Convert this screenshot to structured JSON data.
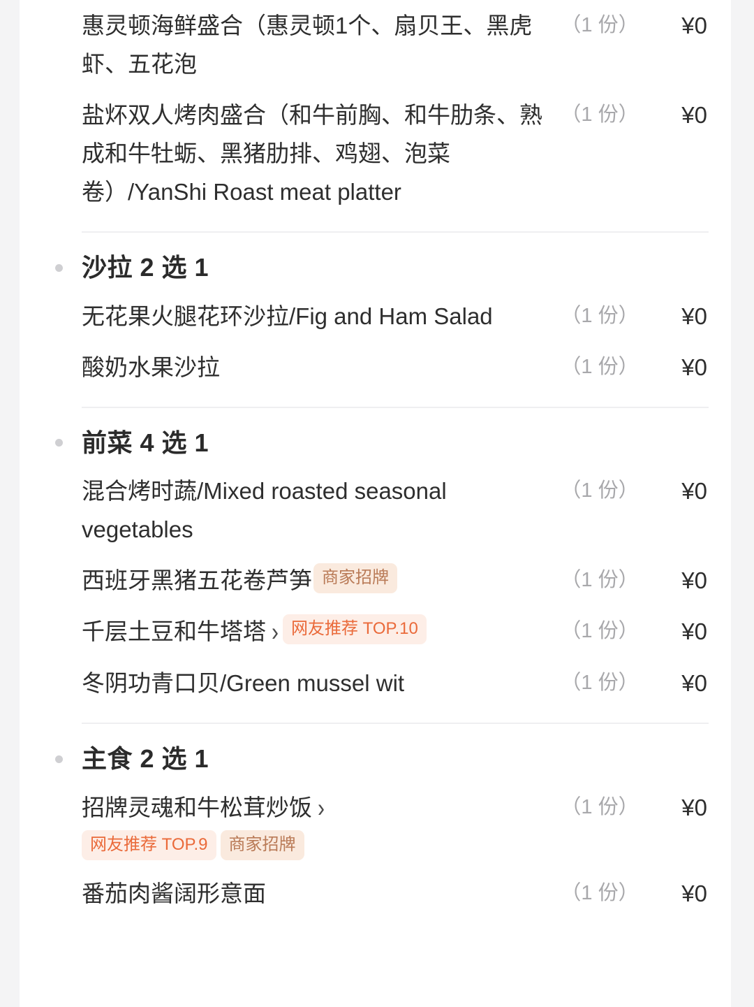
{
  "colors": {
    "page_background": "#f4f4f5",
    "card_background": "#ffffff",
    "primary_text": "#2e2e2e",
    "muted_text": "#a8a8ab",
    "divider": "#efeff1",
    "badge_top_bg": "#fdeee7",
    "badge_top_text": "#ea6a3a",
    "badge_merchant_bg": "#faeade",
    "badge_merchant_text": "#b97a56",
    "bullet": "#cfcfd2"
  },
  "labels": {
    "qty_one_portion": "（1 份）",
    "price_zero": "¥0",
    "chevron": "›"
  },
  "groups": [
    {
      "title": "",
      "has_header": false,
      "dishes": [
        {
          "name": "惠灵顿海鲜盛合（惠灵顿1个、扇贝王、黑虎虾、五花泡",
          "has_chevron": false,
          "badges": [],
          "badges_below": [],
          "qty": "（1 份）",
          "price": "¥0"
        },
        {
          "name": "盐炋双人烤肉盛合（和牛前胸、和牛肋条、熟成和牛牡蛎、黑猪肋排、鸡翅、泡菜卷）/YanShi Roast meat platter",
          "has_chevron": false,
          "badges": [],
          "badges_below": [],
          "qty": "（1 份）",
          "price": "¥0"
        }
      ]
    },
    {
      "title": "沙拉 2 选 1",
      "has_header": true,
      "dishes": [
        {
          "name": "无花果火腿花环沙拉/Fig and Ham Salad",
          "has_chevron": false,
          "badges": [],
          "badges_below": [],
          "qty": "（1 份）",
          "price": "¥0"
        },
        {
          "name": "酸奶水果沙拉",
          "has_chevron": false,
          "badges": [],
          "badges_below": [],
          "qty": "（1 份）",
          "price": "¥0"
        }
      ]
    },
    {
      "title": "前菜 4 选 1",
      "has_header": true,
      "dishes": [
        {
          "name": "混合烤时蔬/Mixed roasted seasonal vegetables",
          "has_chevron": false,
          "badges": [],
          "badges_below": [],
          "qty": "（1 份）",
          "price": "¥0"
        },
        {
          "name": "西班牙黑猪五花卷芦笋",
          "has_chevron": false,
          "badges": [
            {
              "text": "商家招牌",
              "kind": "merchant"
            }
          ],
          "badges_below": [],
          "qty": "（1 份）",
          "price": "¥0"
        },
        {
          "name": "千层土豆和牛塔塔",
          "has_chevron": true,
          "badges": [
            {
              "text": "网友推荐 TOP.10",
              "kind": "top"
            }
          ],
          "badges_below": [],
          "qty": "（1 份）",
          "price": "¥0"
        },
        {
          "name": "冬阴功青口贝/Green mussel wit",
          "has_chevron": false,
          "badges": [],
          "badges_below": [],
          "qty": "（1 份）",
          "price": "¥0"
        }
      ]
    },
    {
      "title": "主食 2 选 1",
      "has_header": true,
      "dishes": [
        {
          "name": "招牌灵魂和牛松茸炒饭",
          "has_chevron": true,
          "badges": [],
          "badges_below": [
            {
              "text": "网友推荐 TOP.9",
              "kind": "top"
            },
            {
              "text": "商家招牌",
              "kind": "merchant"
            }
          ],
          "qty": "（1 份）",
          "price": "¥0"
        },
        {
          "name": "番茄肉酱阔形意面",
          "has_chevron": false,
          "badges": [],
          "badges_below": [],
          "qty": "（1 份）",
          "price": "¥0"
        }
      ]
    }
  ]
}
